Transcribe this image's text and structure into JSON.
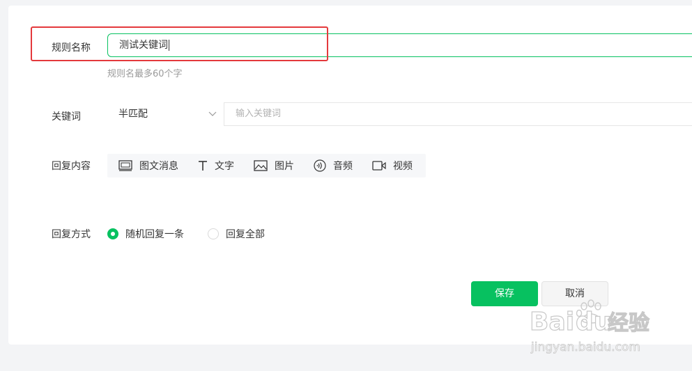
{
  "form": {
    "rule_name": {
      "label": "规则名称",
      "value": "测试关键词",
      "hint": "规则名最多60个字"
    },
    "keyword": {
      "label": "关键词",
      "match_mode": "半匹配",
      "placeholder": "输入关键词"
    },
    "reply_content": {
      "label": "回复内容",
      "types": [
        {
          "icon": "article-icon",
          "label": "图文消息"
        },
        {
          "icon": "text-icon",
          "label": "文字"
        },
        {
          "icon": "image-icon",
          "label": "图片"
        },
        {
          "icon": "audio-icon",
          "label": "音频"
        },
        {
          "icon": "video-icon",
          "label": "视频"
        }
      ]
    },
    "reply_mode": {
      "label": "回复方式",
      "options": [
        {
          "label": "随机回复一条",
          "selected": true
        },
        {
          "label": "回复全部",
          "selected": false
        }
      ]
    },
    "buttons": {
      "save": "保存",
      "cancel": "取消"
    }
  },
  "watermark": {
    "brand": "Bai",
    "brand2": "du",
    "suffix": "经验",
    "url": "jingyan.baidu.com"
  },
  "colors": {
    "accent": "#07c160",
    "highlight": "#e4393c"
  }
}
